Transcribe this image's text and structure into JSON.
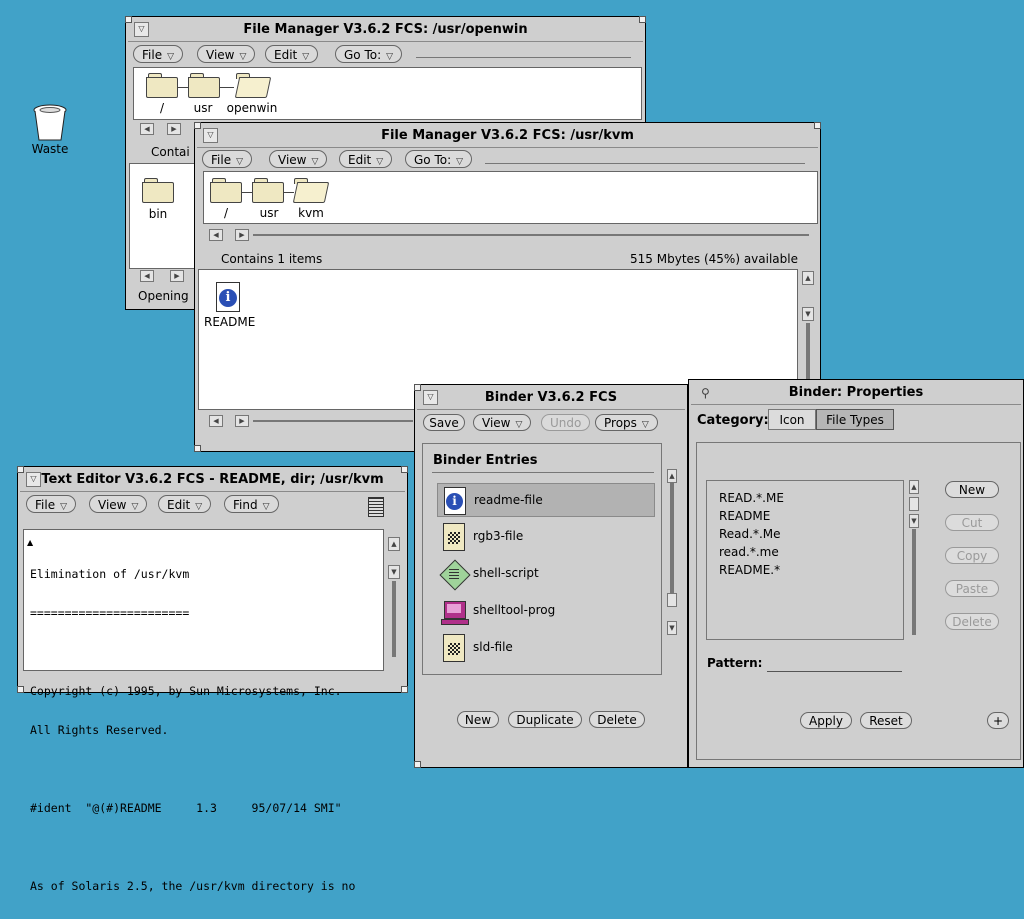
{
  "desktop": {
    "waste_label": "Waste"
  },
  "fm_openwin": {
    "title": "File Manager V3.6.2 FCS: /usr/openwin",
    "menus": [
      "File",
      "View",
      "Edit",
      "Go To:"
    ],
    "path": [
      "/",
      "usr",
      "openwin"
    ],
    "contains_text": "Contai",
    "folders": [
      "bin"
    ],
    "status": "Opening"
  },
  "fm_kvm": {
    "title": "File Manager V3.6.2 FCS: /usr/kvm",
    "menus": [
      "File",
      "View",
      "Edit",
      "Go To:"
    ],
    "path": [
      "/",
      "usr",
      "kvm"
    ],
    "contains_text": "Contains 1 items",
    "space_text": "515 Mbytes (45%) available",
    "files": [
      "README"
    ]
  },
  "text_editor": {
    "title": "Text Editor V3.6.2 FCS - README, dir; /usr/kvm",
    "menus": [
      "File",
      "View",
      "Edit",
      "Find"
    ],
    "lines": [
      "Elimination of /usr/kvm",
      "=======================",
      "",
      "Copyright (c) 1995, by Sun Microsystems, Inc.",
      "All Rights Reserved.",
      "",
      "#ident  \"@(#)README     1.3     95/07/14 SMI\"",
      "",
      "As of Solaris 2.5, the /usr/kvm directory is no"
    ]
  },
  "binder": {
    "title": "Binder V3.6.2 FCS",
    "buttons": {
      "save": "Save",
      "view": "View",
      "undo": "Undo",
      "props": "Props"
    },
    "entries_header": "Binder Entries",
    "entries": [
      "readme-file",
      "rgb3-file",
      "shell-script",
      "shelltool-prog",
      "sld-file"
    ],
    "bottom": {
      "new": "New",
      "duplicate": "Duplicate",
      "delete": "Delete"
    }
  },
  "binder_props": {
    "title": "Binder: Properties",
    "category_label": "Category:",
    "tabs": [
      "Icon",
      "File Types"
    ],
    "patterns": [
      "READ.*.ME",
      "README",
      "Read.*.Me",
      "read.*.me",
      "README.*"
    ],
    "side_buttons": {
      "new": "New",
      "cut": "Cut",
      "copy": "Copy",
      "paste": "Paste",
      "delete": "Delete"
    },
    "pattern_label": "Pattern:",
    "pattern_value": "",
    "apply": "Apply",
    "reset": "Reset",
    "plus": "+"
  }
}
